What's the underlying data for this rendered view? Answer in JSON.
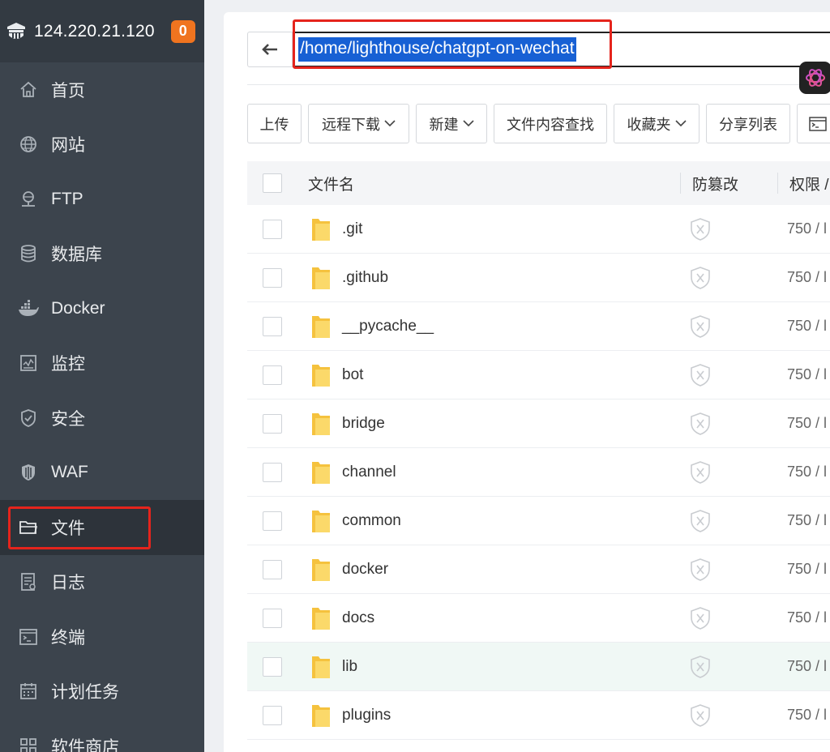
{
  "sidebar": {
    "server_ip": "124.220.21.120",
    "badge": "0",
    "items": [
      {
        "label": "首页",
        "icon": "home-icon"
      },
      {
        "label": "网站",
        "icon": "globe-icon"
      },
      {
        "label": "FTP",
        "icon": "ftp-icon"
      },
      {
        "label": "数据库",
        "icon": "database-icon"
      },
      {
        "label": "Docker",
        "icon": "docker-icon"
      },
      {
        "label": "监控",
        "icon": "monitor-icon"
      },
      {
        "label": "安全",
        "icon": "shield-icon"
      },
      {
        "label": "WAF",
        "icon": "waf-icon"
      },
      {
        "label": "文件",
        "icon": "folder-icon",
        "active": true
      },
      {
        "label": "日志",
        "icon": "log-icon"
      },
      {
        "label": "终端",
        "icon": "terminal-icon"
      },
      {
        "label": "计划任务",
        "icon": "calendar-icon"
      },
      {
        "label": "软件商店",
        "icon": "apps-icon"
      }
    ]
  },
  "path_bar": {
    "path": "/home/lighthouse/chatgpt-on-wechat"
  },
  "toolbar": {
    "upload": "上传",
    "remote_download": "远程下载",
    "new": "新建",
    "search_content": "文件内容查找",
    "favorites": "收藏夹",
    "share_list": "分享列表"
  },
  "table": {
    "headers": {
      "name": "文件名",
      "tamper": "防篡改",
      "permission": "权限 /"
    },
    "rows": [
      {
        "name": ".git",
        "perm": "750 / l"
      },
      {
        "name": ".github",
        "perm": "750 / l"
      },
      {
        "name": "__pycache__",
        "perm": "750 / l"
      },
      {
        "name": "bot",
        "perm": "750 / l"
      },
      {
        "name": "bridge",
        "perm": "750 / l"
      },
      {
        "name": "channel",
        "perm": "750 / l"
      },
      {
        "name": "common",
        "perm": "750 / l"
      },
      {
        "name": "docker",
        "perm": "750 / l"
      },
      {
        "name": "docs",
        "perm": "750 / l"
      },
      {
        "name": "lib",
        "perm": "750 / l",
        "hover": true
      },
      {
        "name": "plugins",
        "perm": "750 / l"
      },
      {
        "name": "",
        "perm": ""
      }
    ]
  },
  "colors": {
    "sidebar_bg": "#3c444d",
    "badge": "#f0741f",
    "highlight_red": "#e5241c",
    "selection_blue": "#1760d4",
    "folder_yellow": "#f7c948"
  }
}
